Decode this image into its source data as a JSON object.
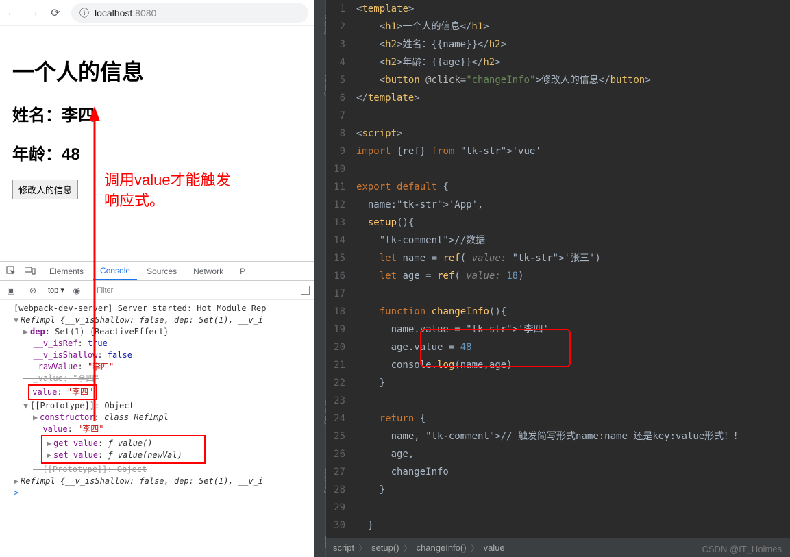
{
  "browser": {
    "url_icon": "info-circle",
    "url_host": "localhost",
    "url_port": ":8080"
  },
  "page": {
    "h1": "一个人的信息",
    "name_label": "姓名：",
    "name_value": "李四",
    "age_label": "年龄：",
    "age_value": "48",
    "button": "修改人的信息"
  },
  "annotation": {
    "line1": "调用value才能触发",
    "line2": "响应式。"
  },
  "devtools": {
    "tabs": [
      "Elements",
      "Console",
      "Sources",
      "Network",
      "P"
    ],
    "active_tab": "Console",
    "toolbar": {
      "context": "top",
      "filter_placeholder": "Filter"
    },
    "console": {
      "server_msg": "[webpack-dev-server] Server started: Hot Module Rep",
      "refimpl_header": "RefImpl {__v_isShallow: false, dep: Set(1), __v_i",
      "dep": "Set(1) {ReactiveEffect}",
      "v_isRef": "true",
      "v_isShallow": "false",
      "rawValue": "\"李四\"",
      "value": "\"李四\"",
      "proto": "Object",
      "constructor": "class RefImpl",
      "proto_value": "\"李四\"",
      "get_value": "ƒ value()",
      "set_value": "ƒ value(newVal)",
      "proto2": "Object",
      "refimpl_footer": "RefImpl {__v_isShallow: false, dep: Set(1), __v_i"
    }
  },
  "editor": {
    "lines": [
      {
        "n": 1,
        "c": "<template>"
      },
      {
        "n": 2,
        "c": "    <h1>一个人的信息</h1>"
      },
      {
        "n": 3,
        "c": "    <h2>姓名：{{name}}</h2>"
      },
      {
        "n": 4,
        "c": "    <h2>年龄：{{age}}</h2>"
      },
      {
        "n": 5,
        "c": "    <button @click=\"changeInfo\">修改人的信息</button>"
      },
      {
        "n": 6,
        "c": "</template>"
      },
      {
        "n": 7,
        "c": ""
      },
      {
        "n": 8,
        "c": "<script>"
      },
      {
        "n": 9,
        "c": "import {ref} from 'vue'"
      },
      {
        "n": 10,
        "c": ""
      },
      {
        "n": 11,
        "c": "export default {"
      },
      {
        "n": 12,
        "c": "  name:'App',"
      },
      {
        "n": 13,
        "c": "  setup(){"
      },
      {
        "n": 14,
        "c": "    //数据"
      },
      {
        "n": 15,
        "c": "    let name = ref( value: '张三')"
      },
      {
        "n": 16,
        "c": "    let age = ref( value: 18)"
      },
      {
        "n": 17,
        "c": ""
      },
      {
        "n": 18,
        "c": "    function changeInfo(){"
      },
      {
        "n": 19,
        "c": "      name.value = '李四'"
      },
      {
        "n": 20,
        "c": "      age.value = 48"
      },
      {
        "n": 21,
        "c": "      console.log(name,age)"
      },
      {
        "n": 22,
        "c": "    }"
      },
      {
        "n": 23,
        "c": ""
      },
      {
        "n": 24,
        "c": "    return {"
      },
      {
        "n": 25,
        "c": "      name, // 触发简写形式name:name 还是key:value形式！！"
      },
      {
        "n": 26,
        "c": "      age,"
      },
      {
        "n": 27,
        "c": "      changeInfo"
      },
      {
        "n": 28,
        "c": "    }"
      },
      {
        "n": 29,
        "c": ""
      },
      {
        "n": 30,
        "c": "  }"
      }
    ],
    "breadcrumb": [
      "script",
      "setup()",
      "changeInfo()",
      "value"
    ],
    "rails": [
      "Project",
      "Commit",
      "Structure",
      "Favorites",
      "npm"
    ],
    "watermark": "CSDN @IT_Holmes"
  }
}
